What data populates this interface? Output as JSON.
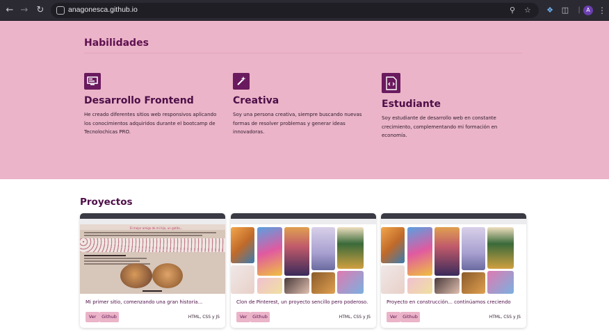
{
  "browser": {
    "url": "anagonesca.github.io",
    "avatar_letter": "A"
  },
  "skills": {
    "title": "Habilidades",
    "items": [
      {
        "icon": "monitor-icon",
        "title": "Desarrollo Frontend",
        "description": "He creado diferentes sitios web responsivos aplicando los conocimientos adquiridos durante el bootcamp de Tecnolochicas PRO."
      },
      {
        "icon": "magic-wand-icon",
        "title": "Creativa",
        "description": "Soy una persona creativa, siempre buscando nuevas formas de resolver problemas y generar ideas innovadoras."
      },
      {
        "icon": "code-file-icon",
        "title": "Estudiante",
        "description": "Soy estudiante de desarrollo web en constante crecimiento, complementando mi formación en economía."
      }
    ]
  },
  "projects": {
    "title": "Proyectos",
    "items": [
      {
        "title": "Mi primer sitio, comenzando una gran historia...",
        "view_label": "Ver",
        "github_label": "Github",
        "tech": "HTML, CSS y JS",
        "preview_heading": "El mejor amigo de mi hijo, un gatito..."
      },
      {
        "title": "Clon de Pinterest, un proyecto sencillo pero poderoso.",
        "view_label": "Ver",
        "github_label": "Github",
        "tech": "HTML, CSS y JS"
      },
      {
        "title": "Proyecto en construcción... continúamos creciendo",
        "view_label": "Ver",
        "github_label": "Github",
        "tech": "HTML, CSS y JS"
      }
    ]
  },
  "colors": {
    "skills_bg": "#ebb4c8",
    "accent": "#4d0e48",
    "button_bg": "#ebb4c8"
  }
}
